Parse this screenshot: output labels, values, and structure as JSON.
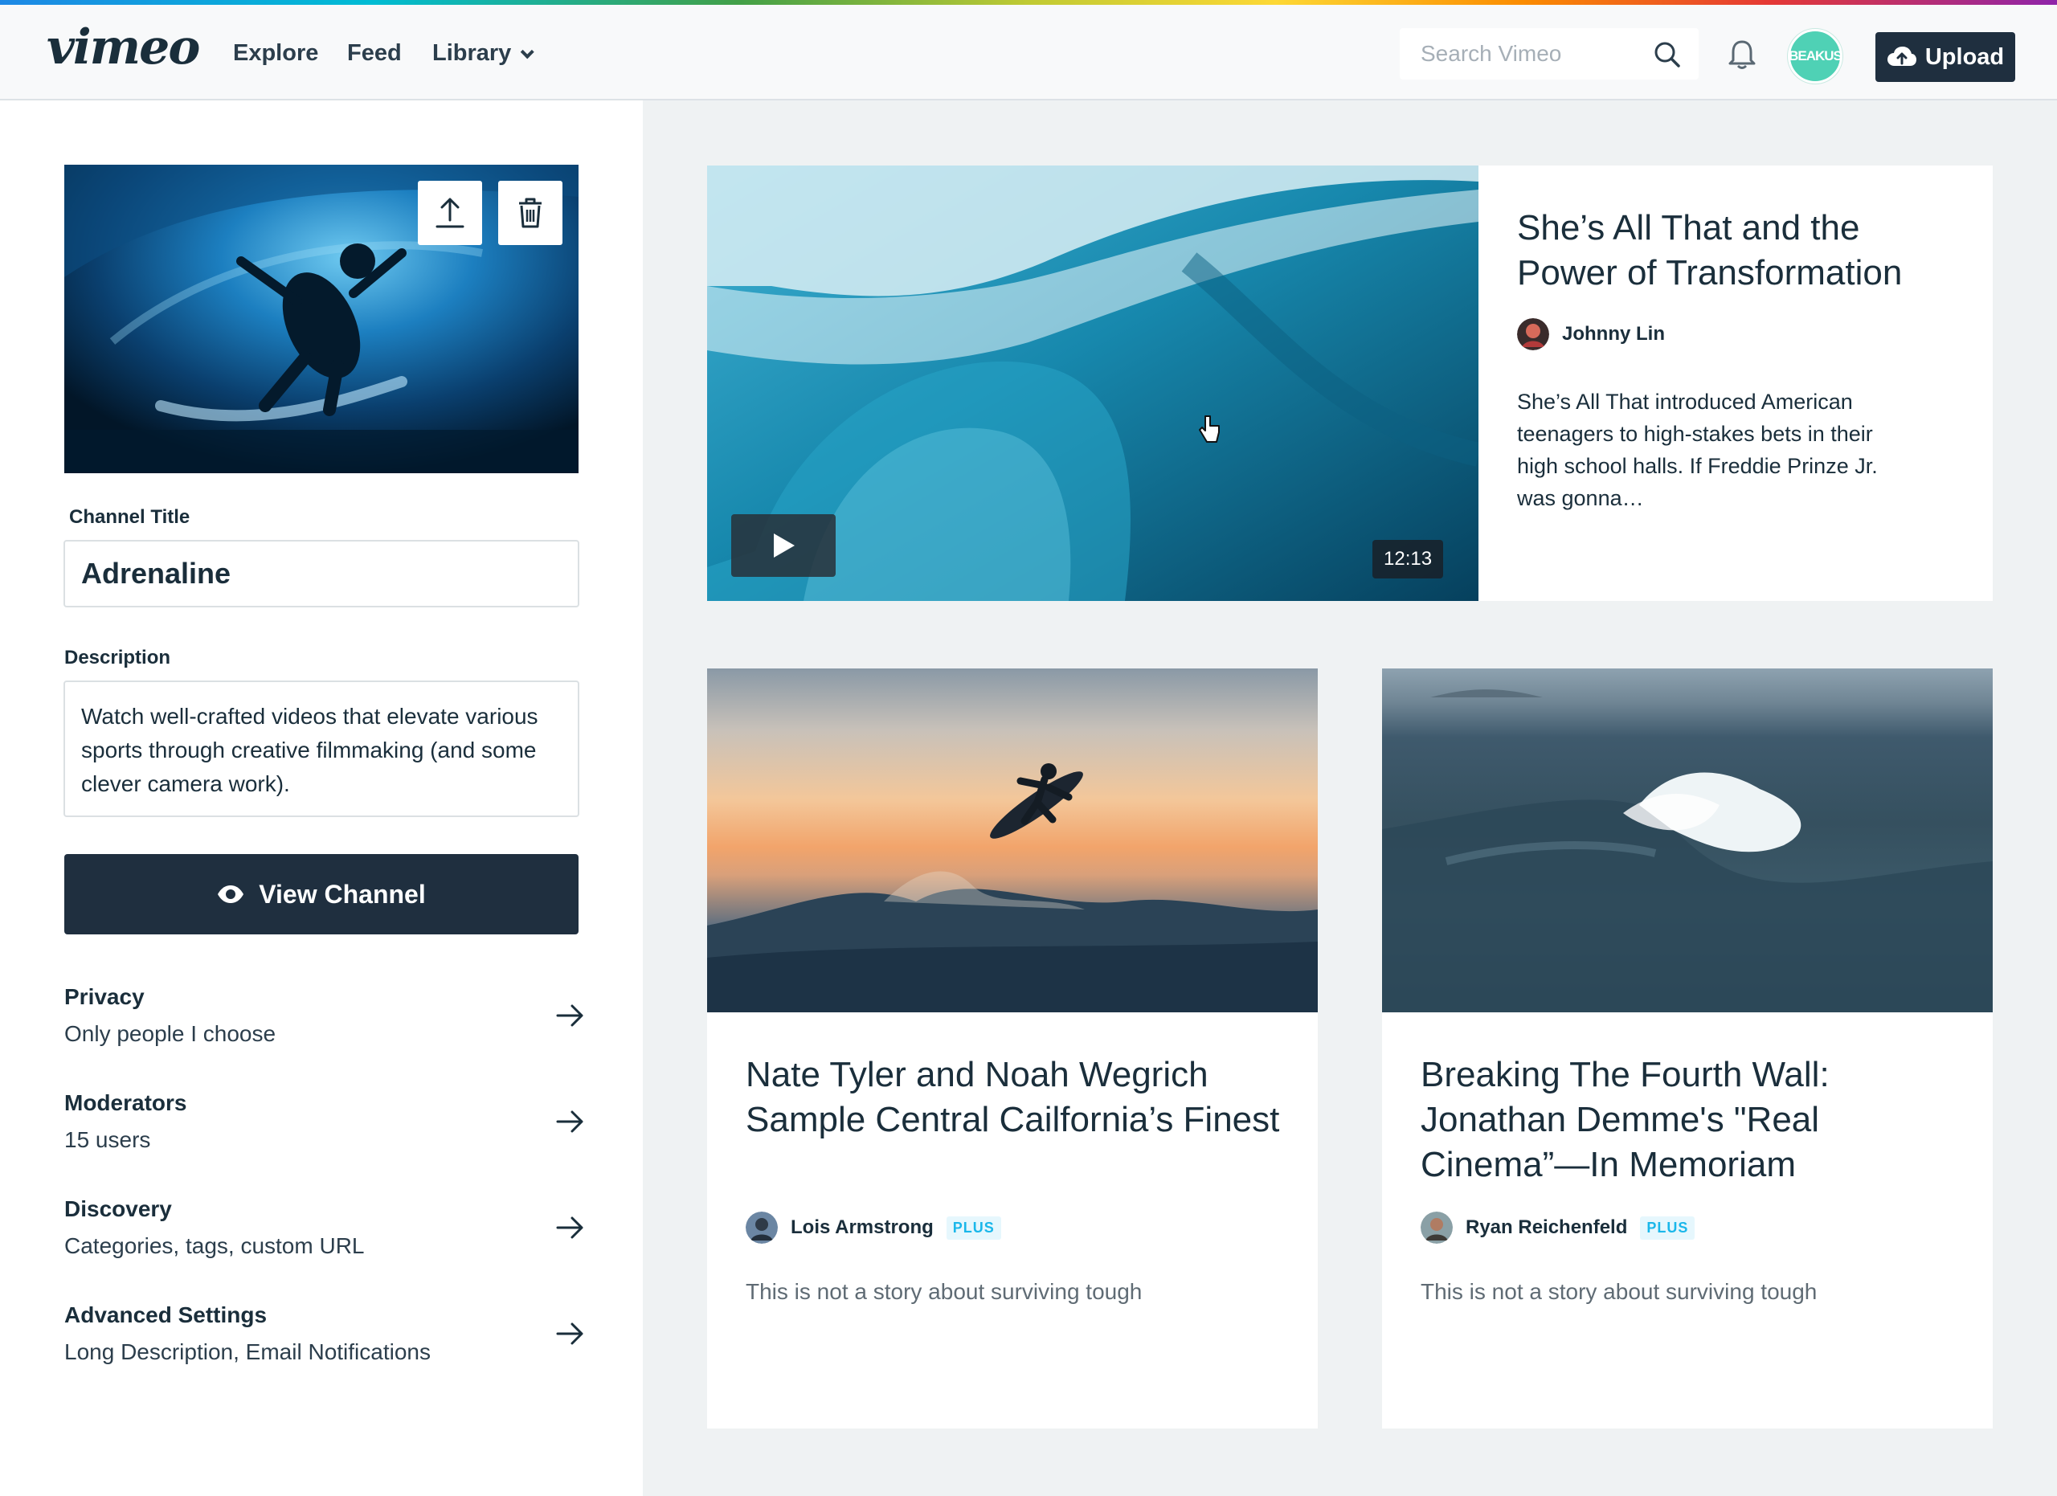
{
  "header": {
    "logo": "vimeo",
    "nav": {
      "explore": "Explore",
      "feed": "Feed",
      "library": "Library"
    },
    "search_placeholder": "Search Vimeo",
    "avatar_text": "BEAKUS",
    "upload_label": "Upload"
  },
  "sidebar": {
    "channel_title_label": "Channel Title",
    "channel_title_value": "Adrenaline",
    "description_label": "Description",
    "description_value": "Watch well-crafted videos that elevate various sports through creative filmmaking (and some clever camera work).",
    "view_channel_label": "View Channel",
    "settings": [
      {
        "title": "Privacy",
        "subtitle": "Only people I choose"
      },
      {
        "title": "Moderators",
        "subtitle": "15 users"
      },
      {
        "title": "Discovery",
        "subtitle": "Categories, tags, custom URL"
      },
      {
        "title": "Advanced Settings",
        "subtitle": "Long Description, Email Notifications"
      }
    ]
  },
  "feature": {
    "title": "She’s All That and the Power of Transformation",
    "author": "Johnny Lin",
    "description": "She’s All That introduced American teenagers to high-stakes bets in their high school halls. If Freddie Prinze Jr. was gonna…",
    "duration": "12:13"
  },
  "cards": [
    {
      "title": "Nate Tyler and Noah Wegrich Sample Central Cailfornia’s Finest",
      "author": "Lois Armstrong",
      "badge": "PLUS",
      "description": "This is not a story about surviving tough"
    },
    {
      "title": "Breaking The Fourth Wall: Jonathan Demme's \"Real Cinema”—In Memoriam",
      "author": "Ryan Reichenfeld",
      "badge": "PLUS",
      "description": "This is not a story about surviving tough"
    }
  ],
  "colors": {
    "dark_navy": "#1f2f3f",
    "text": "#1a2e3b",
    "avatar_teal": "#4fd1b5",
    "plus_blue": "#1ab7ea",
    "page_bg": "#eff2f3"
  },
  "icons": [
    "search-icon",
    "bell-icon",
    "cloud-upload-icon",
    "upload-icon",
    "trash-icon",
    "eye-icon",
    "arrow-right-icon",
    "play-icon",
    "cursor-icon"
  ]
}
